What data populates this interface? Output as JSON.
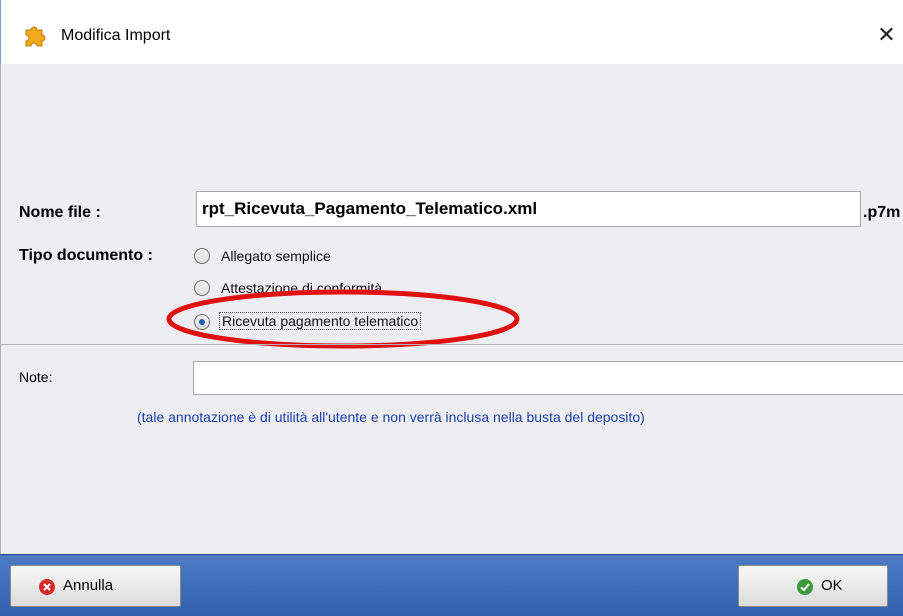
{
  "window": {
    "title": "Modifica Import"
  },
  "form": {
    "nome_file_label": "Nome file :",
    "nome_file_value": "rpt_Ricevuta_Pagamento_Telematico.xml",
    "extension": ".p7m",
    "tipo_documento_label": "Tipo documento :",
    "tipo_options": [
      {
        "label": "Allegato semplice",
        "selected": false
      },
      {
        "label": "Attestazione di conformità",
        "selected": false
      },
      {
        "label": "Ricevuta pagamento telematico",
        "selected": true
      }
    ],
    "note_label": "Note:",
    "note_value": "",
    "note_hint": "(tale annotazione è di utilità all'utente e non verrà inclusa nella busta del deposito)"
  },
  "footer": {
    "cancel_label": "Annulla",
    "ok_label": "OK"
  },
  "icons": {
    "app": "puzzle-icon",
    "close": "close-icon",
    "cancel": "cancel-circle-icon",
    "ok": "check-circle-icon"
  },
  "colors": {
    "footer_bg": "#3a68b6",
    "hint_text": "#1b3fa8",
    "highlight": "#e01010"
  }
}
